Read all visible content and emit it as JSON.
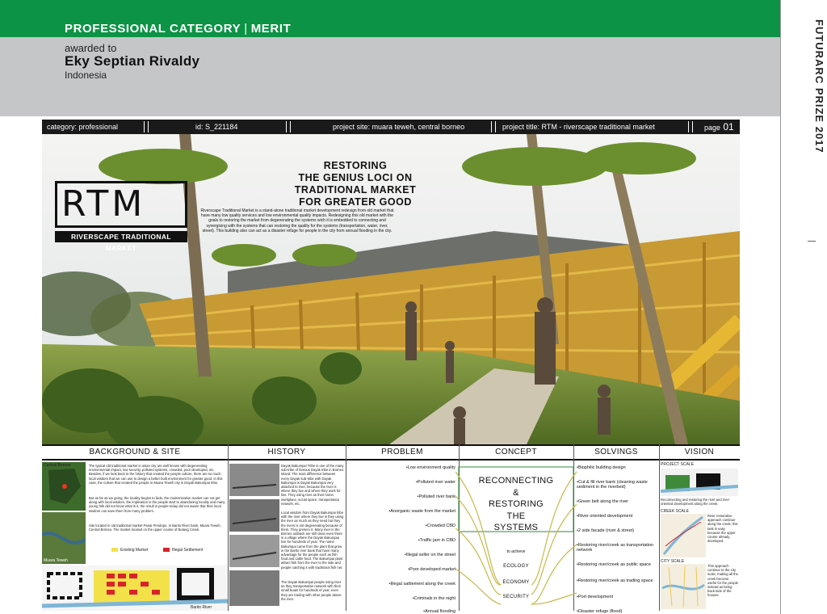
{
  "header": {
    "category": "PROFESSIONAL CATEGORY",
    "separator": "|",
    "award": "MERIT",
    "awarded_to": "awarded to",
    "winner": "Eky Septian Rivaldy",
    "country": "Indonesia"
  },
  "side_label": "FUTURARC PRIZE 2017",
  "info_bar": {
    "category": "category: professional",
    "id": "id: S_221184",
    "site": "project site: muara teweh, central borneo",
    "title": "project title: RTM - riverscape traditional market",
    "page_label": "page",
    "page_number": "01"
  },
  "logo": {
    "letters": "RTM",
    "subtitle": "RIVERSCAPE TRADITIONAL MARKET"
  },
  "headline": [
    "RESTORING",
    "THE GENIUS LOCI ON",
    "TRADITIONAL MARKET",
    "FOR GREATER GOOD"
  ],
  "intro": "Riverscape Traditional Market is a stand-alone traditional market development redesign from old market that have many low quality services and low environmental quality impacts. Redesigning this old market with the goals to restoring the market from degenerating the systems wich it is embedded to connecting and synergising with the systems that can restoring the quality for the systems (transportation, water, river, street). This building also can act as a disaster refuge for people in the city from annual flooding in the city.",
  "sections": {
    "background": "BACKGROUND & SITE",
    "history": "HISTORY",
    "problem": "PROBLEM",
    "concept": "CONCEPT",
    "solvings": "SOLVINGS",
    "vision": "VISION"
  },
  "background_text": [
    "The typical old traditional market in asian city are well known with degenerating environmental impact, low security, polluted systems, crowded, poor developed, etc. Besides, if we look back to the history that created the people culture, there are so much local wisdom that we can use to design a better built environment for greater good. In this case, the culture that created the people in Muara Teweh city is Dayak Bakumpai tribe.",
    "But as far as we going, the locality begins to fade, the modernization market can not get along with local wisdom, the implication is the people start to abandoning locality and many young folk did not know what is it, the result is people today did not aware that their local wisdom can save them from many problem.",
    "Site located in old traditional market Pasar Pendopo, in Barito River bank, Muara Teweh, Central Borneo. The market located on the upper course of Butang Creek."
  ],
  "site_legend": {
    "existing": "Existing Market",
    "illegal": "Illegal Settlement",
    "river": "Barito River",
    "city": "Muara Teweh",
    "region": "Central Borneo"
  },
  "history_text": [
    "Dayak Bakumpai Tribe is one of the many sub-tribe of famous Dayak tribe in Borneo Island. The main difference between every Dayak sub-tribe with Dayak Bakumpai is Dayak Bakumpai very attached to river, because the river is where they live and where they work for live. They using river as their home, workplace, social space, transportation network, etc.",
    "Local wisdom from Dayak Bakumpai tribe with the river where they live is they using the river as much as they need but they the rivers is not degenerating because of them. They preserv it. Many river in the Borneo outback are still clean even there is a village where the Dayak Bakumpai live for hundreds of year. The name Bakumpai came from the plant that grow in the Barito river bank that have many advantage for the people such as fish food and cattle food. The Bakumpai plant attract fish from the river to the side and people catching it with traditional fish net.",
    "The Dayak Bakumpai people using river as they transportation network with their small boats for hundreds of year, even they are trading with other people above the river."
  ],
  "problems": [
    "Low environment quality",
    "Polluted river water",
    "Polluted river bank",
    "Anorganic waste from the market",
    "Crowded CBD",
    "Traffic jam in CBD",
    "Illegal seller on the street",
    "Poor developed market",
    "Illegal sattlement along the creek",
    "Criminals in the night",
    "Annual flooding"
  ],
  "concept": {
    "lines": [
      "RECONNECTING",
      "&",
      "RESTORING",
      "THE",
      "SYSTEMS"
    ],
    "to_achieve": "to achieve",
    "pillars": [
      "ECOLOGY",
      "ECONOMY",
      "SECURITY"
    ]
  },
  "solvings": [
    "Biophilic building design",
    "Cut & fill river bank (cleaning waste sediment in the riverbed)",
    "Green belt along the river",
    "River oriented development",
    "2 side facade (river & street)",
    "Restoring river/creek as transportation network",
    "Restoring river/creek as public space",
    "Restoring river/creek as trading space",
    "Port development",
    "Disaster refuge (flood)"
  ],
  "vision": {
    "project_scale": "PROJECT SCALE",
    "project_text": "Reconnecting and restoring the river and river oriented development along the creek.",
    "creek_scale": "CREEK SCALE",
    "creek_text": "River restorative approach continue along the creek, this task is easy because the upper course already developed.",
    "city_scale": "CITY SCALE",
    "city_text": "This approach continue to the city scale, making all the creek become useful for the people instead as being back-side of the houses."
  },
  "colors": {
    "green": "#0c9345",
    "grey": "#c5c6c8",
    "dark": "#1a1a1a",
    "concept_green": "#2e8b3a"
  }
}
